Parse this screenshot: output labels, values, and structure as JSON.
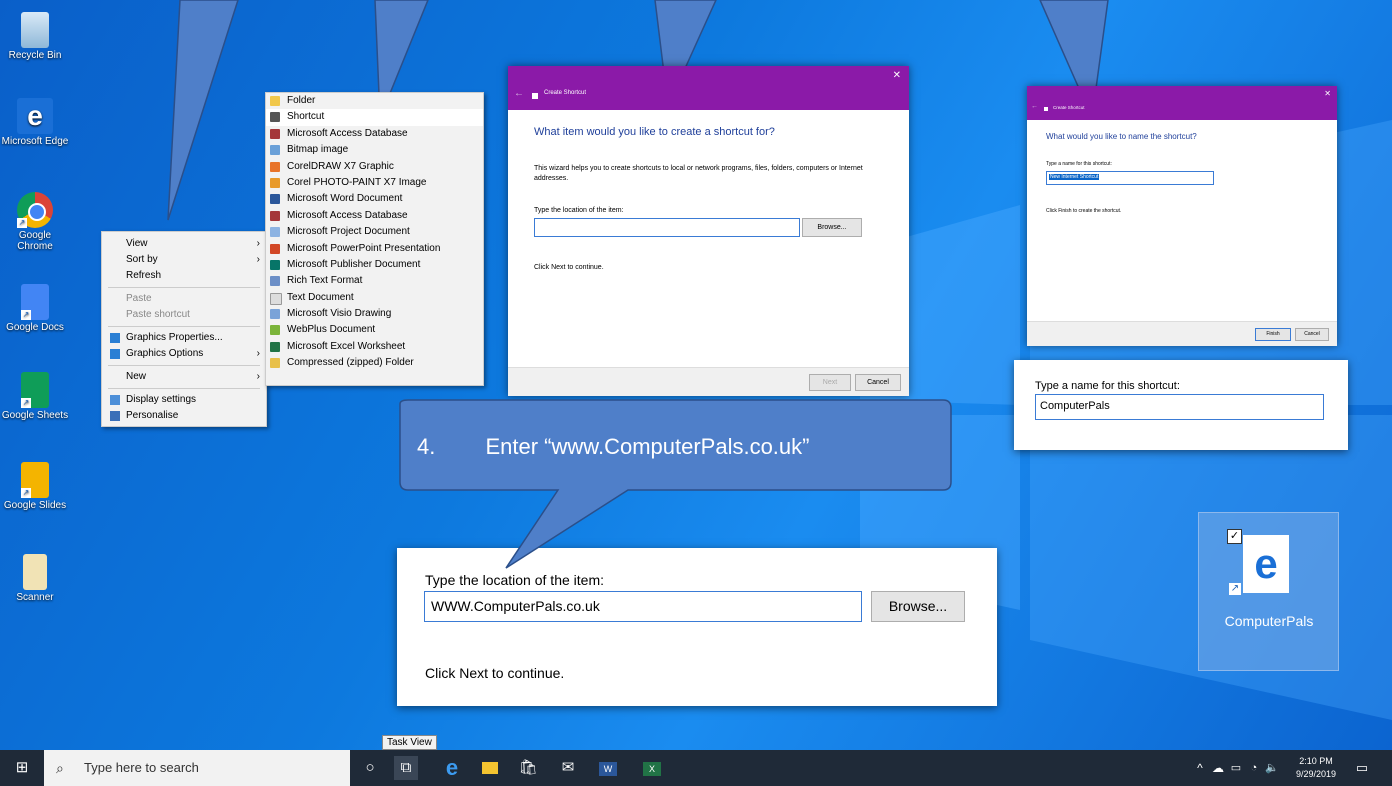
{
  "desktop_icons": [
    {
      "label": "Recycle Bin",
      "icon": "recycle-bin-icon"
    },
    {
      "label": "Microsoft Edge",
      "icon": "edge-icon"
    },
    {
      "label": "Google Chrome",
      "icon": "chrome-icon"
    },
    {
      "label": "Google Docs",
      "icon": "docs-icon"
    },
    {
      "label": "Google Sheets",
      "icon": "sheets-icon"
    },
    {
      "label": "Google Slides",
      "icon": "slides-icon"
    },
    {
      "label": "Scanner",
      "icon": "scanner-icon"
    }
  ],
  "context_menu": {
    "items": [
      {
        "label": "View"
      },
      {
        "label": "Sort by"
      },
      {
        "label": "Refresh"
      },
      {
        "label": "Paste"
      },
      {
        "label": "Paste shortcut"
      },
      {
        "label": "Graphics Properties..."
      },
      {
        "label": "Graphics Options"
      },
      {
        "label": "New"
      },
      {
        "label": "Display settings"
      },
      {
        "label": "Personalise"
      }
    ]
  },
  "new_submenu": {
    "items": [
      {
        "label": "Folder"
      },
      {
        "label": "Shortcut"
      },
      {
        "label": "Microsoft Access Database"
      },
      {
        "label": "Bitmap image"
      },
      {
        "label": "CorelDRAW X7 Graphic"
      },
      {
        "label": "Corel PHOTO-PAINT X7 Image"
      },
      {
        "label": "Microsoft Word Document"
      },
      {
        "label": "Microsoft Access Database"
      },
      {
        "label": "Microsoft Project Document"
      },
      {
        "label": "Microsoft PowerPoint Presentation"
      },
      {
        "label": "Microsoft Publisher Document"
      },
      {
        "label": "Rich Text Format"
      },
      {
        "label": "Text Document"
      },
      {
        "label": "Microsoft Visio Drawing"
      },
      {
        "label": "WebPlus Document"
      },
      {
        "label": "Microsoft Excel Worksheet"
      },
      {
        "label": "Compressed (zipped) Folder"
      }
    ]
  },
  "dialog1": {
    "title": "Create Shortcut",
    "heading": "What item would you like to create a shortcut for?",
    "description": "This wizard helps you to create shortcuts to local or network programs, files, folders, computers or Internet addresses.",
    "field_label": "Type the location of the item:",
    "browse": "Browse...",
    "hint": "Click Next to continue.",
    "next": "Next",
    "cancel": "Cancel"
  },
  "dialog2": {
    "title": "Create Shortcut",
    "heading": "What would you like to name the shortcut?",
    "field_label": "Type a name for this shortcut:",
    "field_value": "New Internet Shortcut",
    "hint": "Click Finish to create the shortcut.",
    "finish": "Finish",
    "cancel": "Cancel"
  },
  "zoom_name": {
    "label": "Type a name for this shortcut:",
    "value": "ComputerPals"
  },
  "zoom_location": {
    "label": "Type the location of the item:",
    "value": "WWW.ComputerPals.co.uk",
    "browse": "Browse...",
    "hint": "Click Next to continue."
  },
  "callout": {
    "number": "4.",
    "text": "Enter “www.ComputerPals.co.uk”"
  },
  "new_shortcut_icon": {
    "label": "ComputerPals"
  },
  "taskbar": {
    "search_placeholder": "Type here to search",
    "tooltip": "Task View",
    "time": "2:10 PM",
    "date": "9/29/2019"
  }
}
